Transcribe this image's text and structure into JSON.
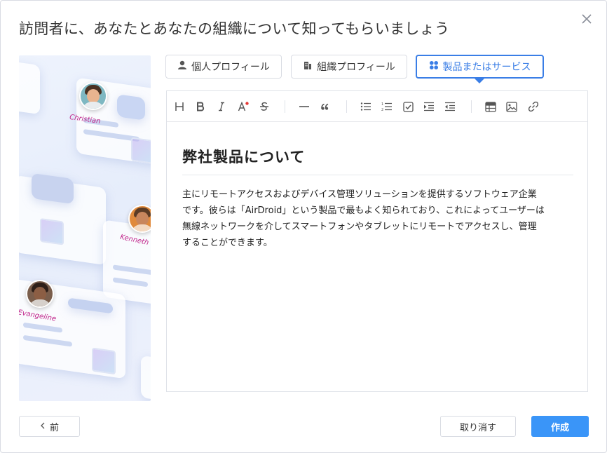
{
  "dialog": {
    "title": "訪問者に、あなたとあなたの組織について知ってもらいましょう",
    "close_icon": "close-icon"
  },
  "illustration": {
    "people": [
      "Christian",
      "Kenneth",
      "Evangeline"
    ]
  },
  "tabs": [
    {
      "label": "個人プロフィール",
      "icon": "user-icon",
      "active": false
    },
    {
      "label": "組織プロフィール",
      "icon": "building-icon",
      "active": false
    },
    {
      "label": "製品またはサービス",
      "icon": "grid-icon",
      "active": true
    }
  ],
  "toolbar": {
    "items": [
      "heading-icon",
      "bold-icon",
      "italic-icon",
      "font-color-icon",
      "strikethrough-icon",
      "horizontal-rule-icon",
      "quote-icon",
      "bullet-list-icon",
      "numbered-list-icon",
      "checklist-icon",
      "indent-icon",
      "outdent-icon",
      "table-icon",
      "image-icon",
      "link-icon"
    ]
  },
  "document": {
    "title": "弊社製品について",
    "body": "主にリモートアクセスおよびデバイス管理ソリューションを提供するソフトウェア企業\nです。彼らは「AirDroid」という製品で最もよく知られており、これによってユーザーは\n無線ネットワークを介してスマートフォンやタブレットにリモートでアクセスし、管理\nすることができます。"
  },
  "footer": {
    "prev_label": "前",
    "cancel_label": "取り消す",
    "create_label": "作成"
  },
  "colors": {
    "accent": "#3a7ee6",
    "primary_button": "#3a95f8",
    "name_text": "#c0248a"
  }
}
